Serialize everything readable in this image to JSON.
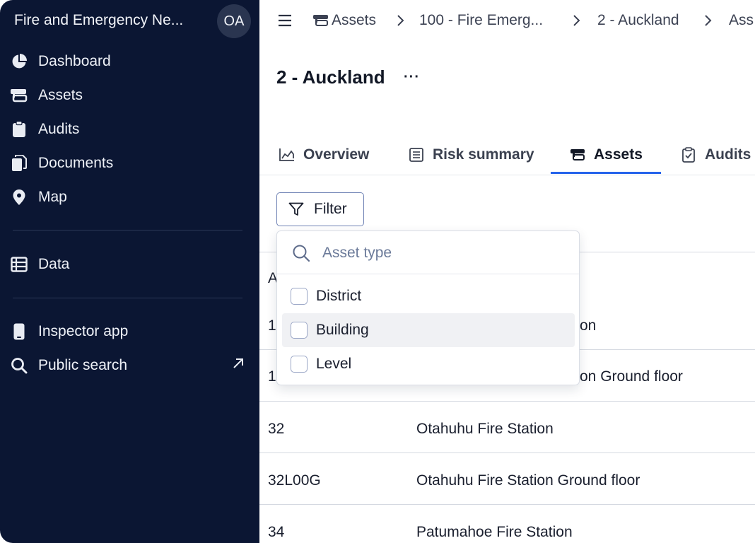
{
  "sidebar": {
    "org_name": "Fire and Emergency Ne...",
    "avatar_initials": "OA",
    "nav": [
      {
        "label": "Dashboard",
        "icon": "pie-chart-icon"
      },
      {
        "label": "Assets",
        "icon": "assets-icon"
      },
      {
        "label": "Audits",
        "icon": "clipboard-icon"
      },
      {
        "label": "Documents",
        "icon": "documents-icon"
      },
      {
        "label": "Map",
        "icon": "map-pin-icon"
      }
    ],
    "data_item": {
      "label": "Data",
      "icon": "table-icon"
    },
    "inspector_item": {
      "label": "Inspector app",
      "icon": "phone-icon"
    },
    "public_search_item": {
      "label": "Public search",
      "icon": "search-icon",
      "trailing_icon": "external-link-icon"
    }
  },
  "breadcrumb": {
    "items": [
      "Assets",
      "100 - Fire Emerg...",
      "2 - Auckland",
      "Ass"
    ]
  },
  "page": {
    "title": "2 - Auckland",
    "more": "···"
  },
  "tabs": [
    {
      "label": "Overview",
      "icon": "area-chart-icon"
    },
    {
      "label": "Risk summary",
      "icon": "list-icon"
    },
    {
      "label": "Assets",
      "icon": "assets-icon",
      "active": true
    },
    {
      "label": "Audits",
      "icon": "clipboard-check-icon"
    }
  ],
  "filter": {
    "label": "Filter",
    "search_placeholder": "Asset type",
    "options": [
      {
        "label": "District",
        "checked": false
      },
      {
        "label": "Building",
        "checked": false,
        "hovered": true
      },
      {
        "label": "Level",
        "checked": false
      }
    ]
  },
  "table": {
    "header_first_letter": "A",
    "rows": [
      {
        "id": "1",
        "name": "on"
      },
      {
        "id": "1",
        "name": "on Ground floor"
      },
      {
        "id": "32",
        "name": "Otahuhu Fire Station"
      },
      {
        "id": "32L00G",
        "name": "Otahuhu Fire Station Ground floor"
      },
      {
        "id": "34",
        "name": "Patumahoe Fire Station"
      }
    ]
  },
  "colors": {
    "sidebar_bg": "#0b1633",
    "accent": "#2563eb"
  }
}
